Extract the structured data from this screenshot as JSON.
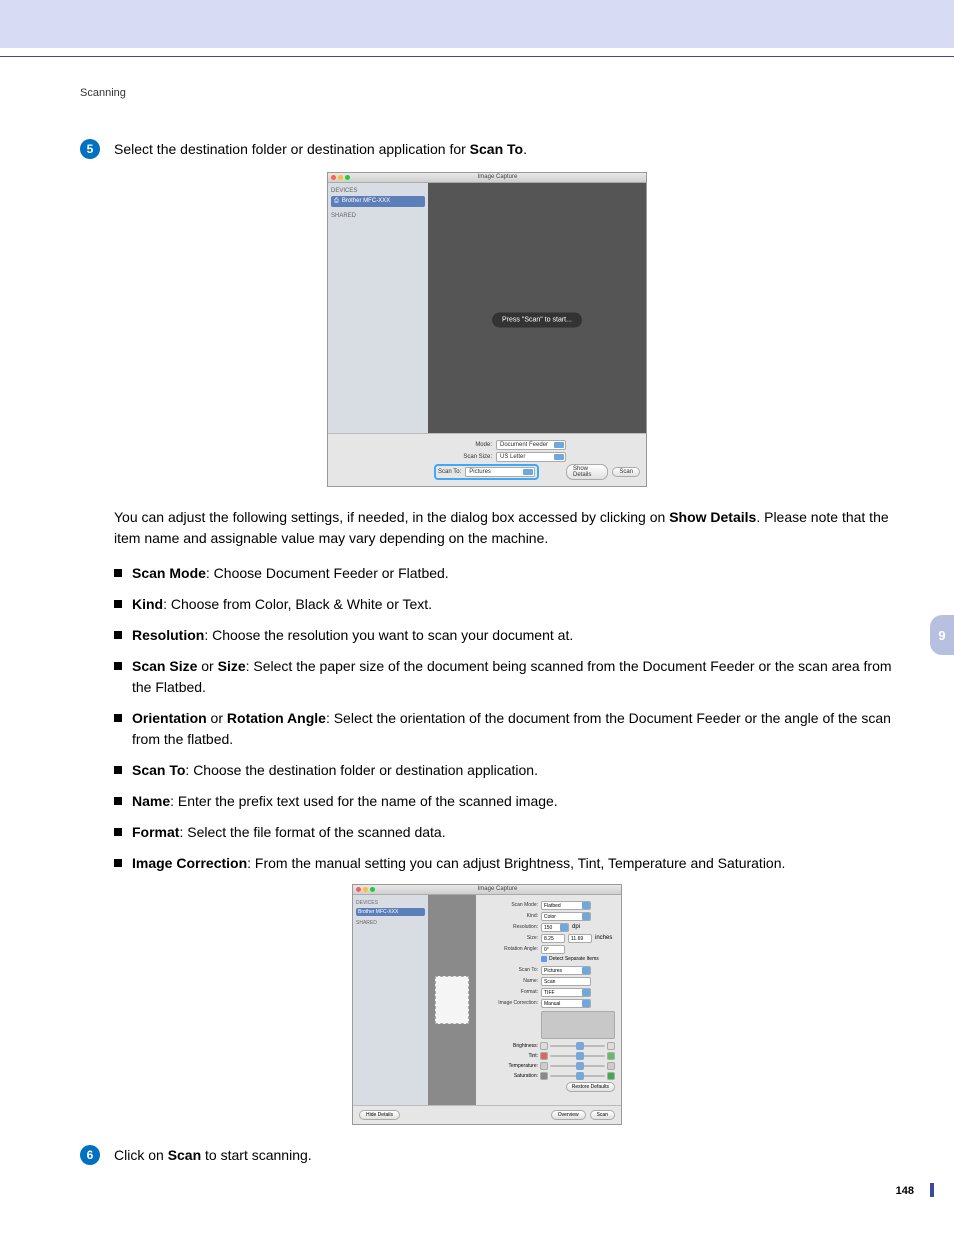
{
  "section_title": "Scanning",
  "side_tab": "9",
  "page_number": "148",
  "step5": {
    "num": "5",
    "text_a": "Select the destination folder or destination application for ",
    "text_b": "Scan To",
    "text_c": "."
  },
  "sc1": {
    "title": "Image Capture",
    "devices_hdr": "DEVICES",
    "device": "Brother MFC-XXX",
    "shared_hdr": "SHARED",
    "hint": "Press \"Scan\" to start...",
    "mode_lbl": "Mode:",
    "mode_val": "Document Feeder",
    "size_lbl": "Scan Size:",
    "size_val": "US Letter",
    "scanto_lbl": "Scan To:",
    "scanto_val": "Pictures",
    "show_details": "Show Details",
    "scan": "Scan"
  },
  "intro": {
    "a": "You can adjust the following settings, if needed, in the dialog box accessed by clicking on ",
    "b": "Show Details",
    "c": ". Please note that the item name and assignable value may vary depending on the machine."
  },
  "bullets": [
    {
      "b": "Scan Mode",
      "t": ": Choose Document Feeder or Flatbed."
    },
    {
      "b": "Kind",
      "t": ": Choose from Color, Black & White or Text."
    },
    {
      "b": "Resolution",
      "t": ": Choose the resolution you want to scan your document at."
    },
    {
      "b": "Scan Size",
      "b2": " or ",
      "b3": "Size",
      "t": ": Select the paper size of the document being scanned from the Document Feeder or the scan area from the Flatbed."
    },
    {
      "b": "Orientation",
      "b2": " or ",
      "b3": "Rotation Angle",
      "t": ": Select the orientation of the document from the Document Feeder or the angle of the scan from the flatbed."
    },
    {
      "b": "Scan To",
      "t": ": Choose the destination folder or destination application."
    },
    {
      "b": "Name",
      "t": ": Enter the prefix text used for the name of the scanned image."
    },
    {
      "b": "Format",
      "t": ": Select the file format of the scanned data."
    },
    {
      "b": "Image Correction",
      "t": ": From the manual setting you can adjust Brightness, Tint, Temperature and Saturation."
    }
  ],
  "sc2": {
    "title": "Image Capture",
    "devices_hdr": "DEVICES",
    "device": "Brother MFC-XXX",
    "shared_hdr": "SHARED",
    "scanmode_lbl": "Scan Mode:",
    "scanmode_val": "Flatbed",
    "kind_lbl": "Kind:",
    "kind_val": "Color",
    "res_lbl": "Resolution:",
    "res_val": "150",
    "res_unit": "dpi",
    "size_lbl": "Size:",
    "size_w": "8.25",
    "size_h": "11.69",
    "size_unit": "inches",
    "rot_lbl": "Rotation Angle:",
    "rot_val": "0°",
    "detect": "Detect Separate Items",
    "scanto_lbl": "Scan To:",
    "scanto_val": "Pictures",
    "name_lbl": "Name:",
    "name_val": "Scan",
    "format_lbl": "Format:",
    "format_val": "TIFF",
    "ic_lbl": "Image Correction:",
    "ic_val": "Manual",
    "bright": "Brightness:",
    "tint": "Tint:",
    "temp": "Temperature:",
    "sat": "Saturation:",
    "restore": "Restore Defaults",
    "hide": "Hide Details",
    "overview": "Overview",
    "scan": "Scan"
  },
  "step6": {
    "num": "6",
    "a": "Click on ",
    "b": "Scan",
    "c": " to start scanning."
  }
}
